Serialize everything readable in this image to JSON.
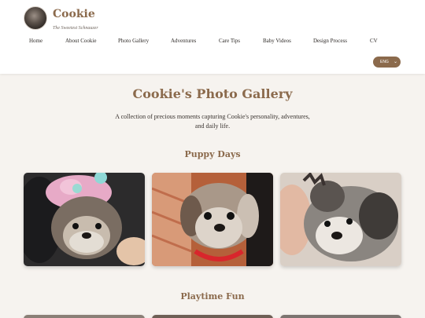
{
  "brand": {
    "name": "Cookie",
    "tagline": "The Sweetest Schnauzer"
  },
  "nav": [
    "Home",
    "About Cookie",
    "Photo Gallery",
    "Adventures",
    "Care Tips",
    "Baby Videos",
    "Design Process",
    "CV"
  ],
  "language": {
    "selected": "ENG"
  },
  "page": {
    "title": "Cookie's Photo Gallery",
    "description": "A collection of precious moments capturing Cookie's personality, adventures, and daily life."
  },
  "sections": [
    {
      "title": "Puppy Days"
    },
    {
      "title": "Playtime Fun"
    }
  ],
  "colors": {
    "accent": "#8b6a4c",
    "background": "#f6f3ef",
    "header": "#ffffff"
  }
}
